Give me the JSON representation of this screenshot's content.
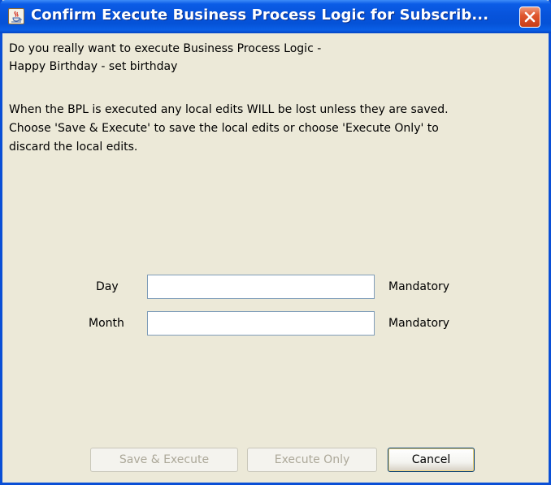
{
  "window": {
    "title": "Confirm Execute Business Process Logic for Subscrib...",
    "icon": "java-cup-icon",
    "close_icon": "close-icon",
    "title_bar_color": "#0553d9",
    "close_button_color": "#e0572f"
  },
  "message": {
    "line1": "Do you really want to execute Business Process Logic -",
    "line2": "Happy Birthday - set birthday",
    "line3": "When the BPL is executed any local edits WILL be lost unless they are saved.",
    "line4": "Choose 'Save & Execute' to save the local edits or choose 'Execute Only' to",
    "line5": "discard the local edits."
  },
  "form": {
    "fields": [
      {
        "label": "Day",
        "value": "",
        "hint": "Mandatory"
      },
      {
        "label": "Month",
        "value": "",
        "hint": "Mandatory"
      }
    ]
  },
  "buttons": {
    "save_execute": {
      "label": "Save & Execute",
      "enabled": false
    },
    "execute_only": {
      "label": "Execute Only",
      "enabled": false
    },
    "cancel": {
      "label": "Cancel",
      "enabled": true
    }
  }
}
